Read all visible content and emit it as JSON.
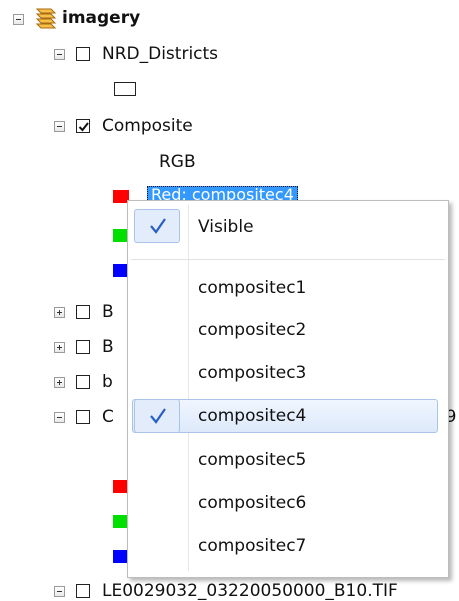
{
  "tree": {
    "root_label": "imagery",
    "nrd_label": "NRD_Districts",
    "composite_label": "Composite",
    "rgb_label": "RGB",
    "band_label": "Red:   compositec4",
    "partial_rows": [
      {
        "text": "B"
      },
      {
        "text": "B"
      },
      {
        "text": "b"
      },
      {
        "text": "C"
      }
    ],
    "row_tail_text": ")9",
    "bottom_label": "LE0029032_03220050000_B10.TIF"
  },
  "colors": {
    "red": "#ff0000",
    "green": "#00e000",
    "blue": "#0000ff",
    "selection": "#3399ff",
    "check": "#2a5fc4",
    "layer_icon": "#e8a020"
  },
  "icons": {
    "layer_group": "layers-icon",
    "check": "checkmark-icon"
  },
  "menu": {
    "visible_label": "Visible",
    "items": [
      "compositec1",
      "compositec2",
      "compositec3",
      "compositec4",
      "compositec5",
      "compositec6",
      "compositec7"
    ],
    "checked_item": "compositec4"
  }
}
